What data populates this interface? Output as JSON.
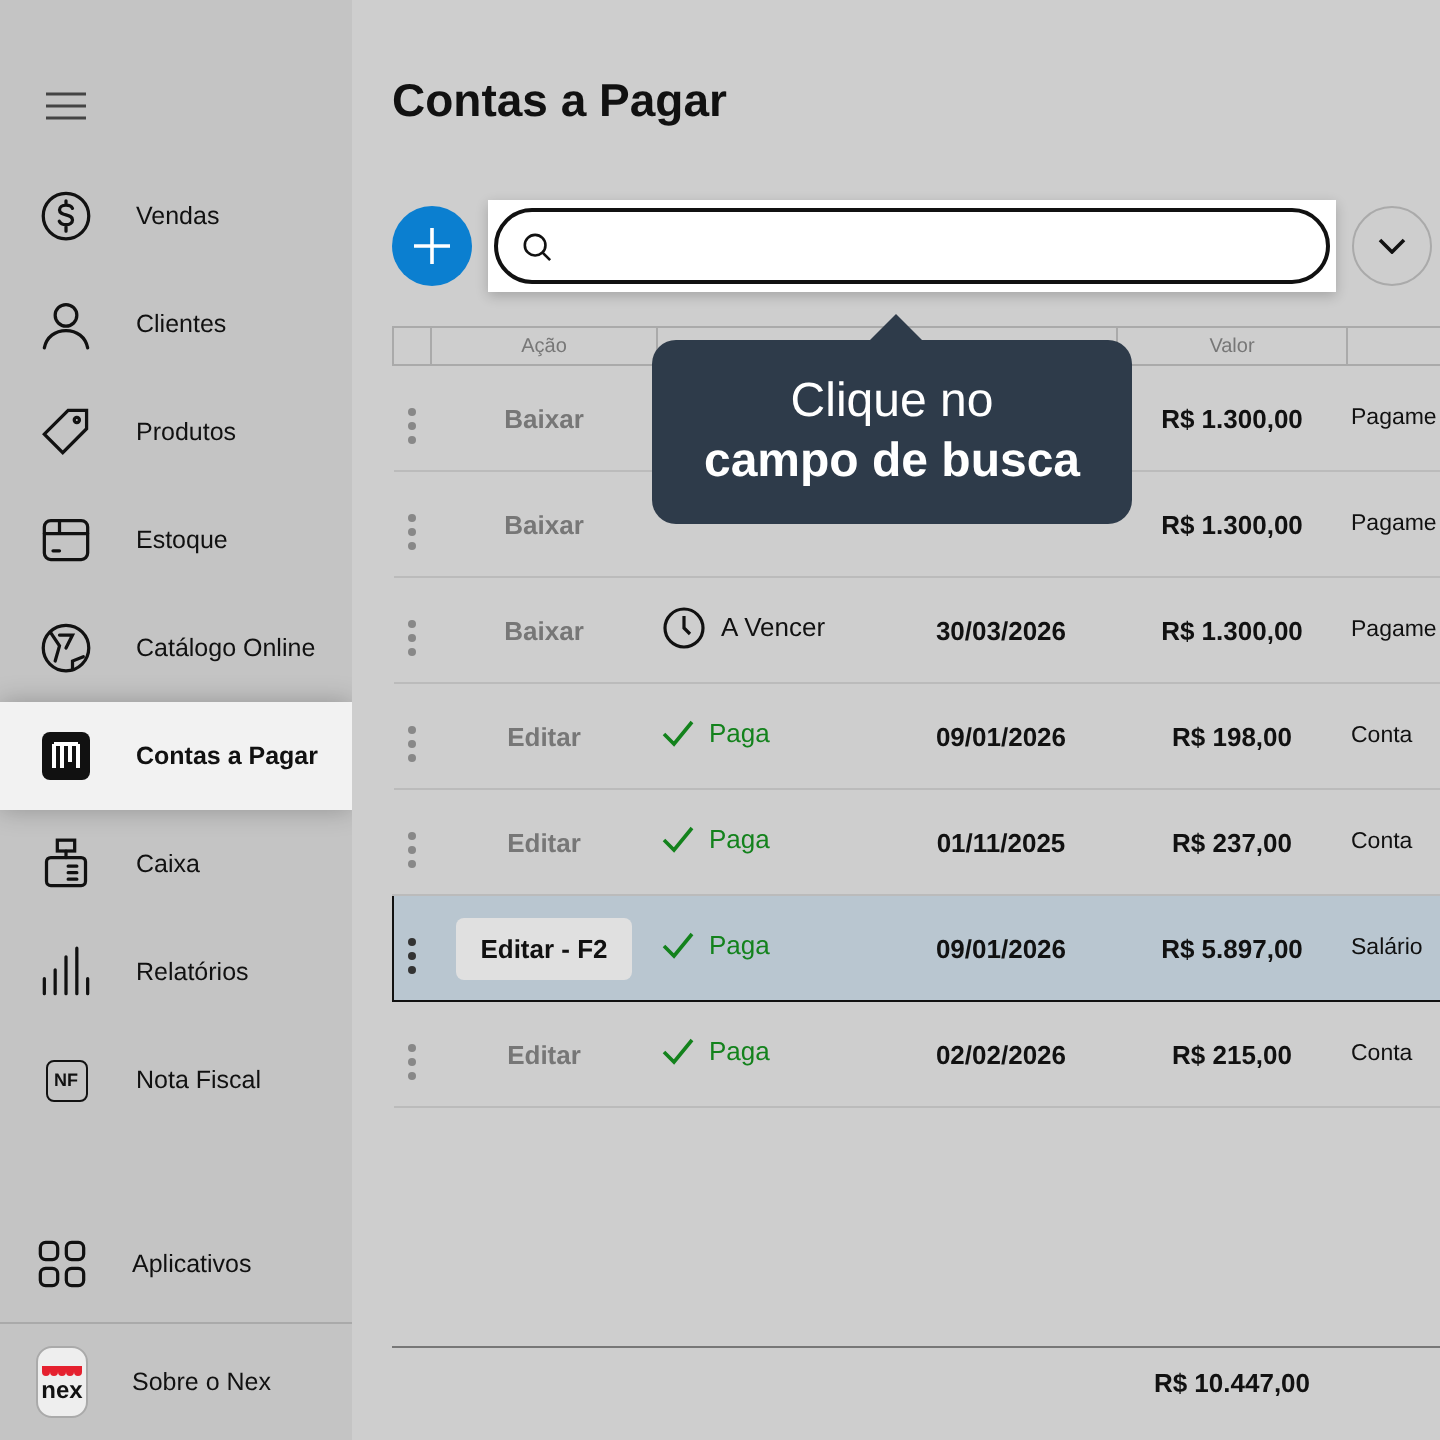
{
  "sidebar": {
    "items": [
      {
        "label": "Vendas",
        "selected": false
      },
      {
        "label": "Clientes",
        "selected": false
      },
      {
        "label": "Produtos",
        "selected": false
      },
      {
        "label": "Estoque",
        "selected": false
      },
      {
        "label": "Catálogo Online",
        "selected": false
      },
      {
        "label": "Contas a Pagar",
        "selected": true
      },
      {
        "label": "Caixa",
        "selected": false
      },
      {
        "label": "Relatórios",
        "selected": false
      },
      {
        "label": "Nota Fiscal",
        "icon_text": "NF",
        "selected": false
      }
    ],
    "bottom": [
      {
        "label": "Aplicativos"
      },
      {
        "label": "Sobre o Nex",
        "icon_text": "nex"
      }
    ]
  },
  "page_title": "Contas a Pagar",
  "tooltip": {
    "line_1": "Clique no",
    "line_2": "campo de busca"
  },
  "table": {
    "columns": [
      "Ação",
      "Valor"
    ],
    "rows": [
      {
        "action": "Baixar",
        "value": "R$ 1.300,00",
        "description": "Pagame",
        "selected": false
      },
      {
        "action": "Baixar",
        "value": "R$ 1.300,00",
        "description": "Pagame",
        "selected": false
      },
      {
        "action": "Baixar",
        "status": "A Vencer",
        "kind": "pending",
        "due": "30/03/2026",
        "value": "R$ 1.300,00",
        "description": "Pagame",
        "selected": false
      },
      {
        "action": "Editar",
        "status": "Paga",
        "kind": "paid",
        "due": "09/01/2026",
        "value": "R$ 198,00",
        "description": "Conta",
        "selected": false
      },
      {
        "action": "Editar",
        "status": "Paga",
        "kind": "paid",
        "due": "01/11/2025",
        "value": "R$ 237,00",
        "description": "Conta",
        "selected": false
      },
      {
        "action": "Editar - F2",
        "status": "Paga",
        "kind": "paid",
        "due": "09/01/2026",
        "value": "R$ 5.897,00",
        "description": "Salário",
        "selected": true
      },
      {
        "action": "Editar",
        "status": "Paga",
        "kind": "paid",
        "due": "02/02/2026",
        "value": "R$ 215,00",
        "description": "Conta",
        "selected": false
      }
    ],
    "total": "R$ 10.447,00"
  }
}
